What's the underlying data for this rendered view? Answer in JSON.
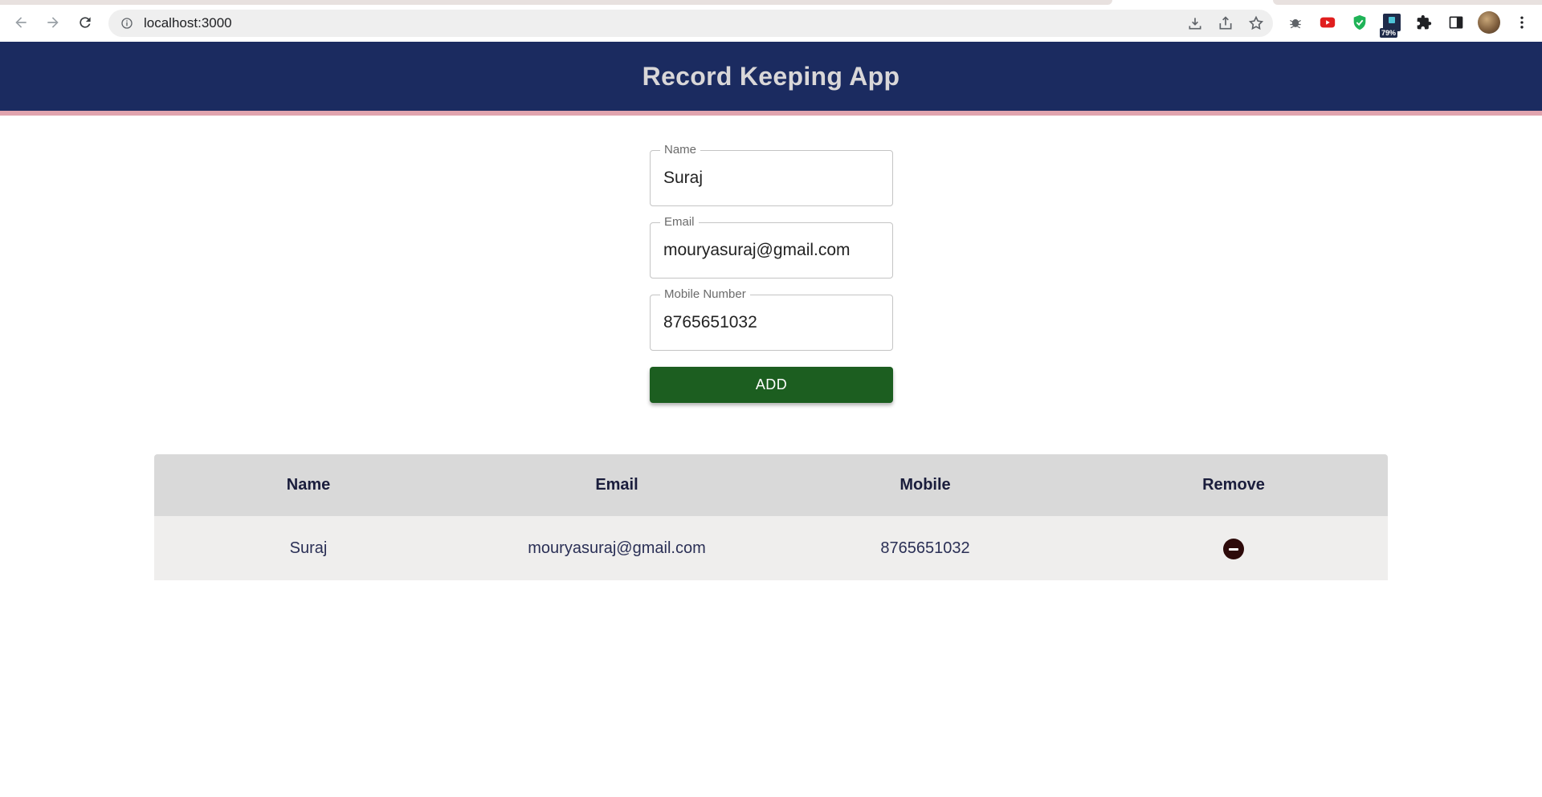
{
  "browser": {
    "url": "localhost:3000",
    "battery_badge": "79%"
  },
  "header": {
    "title": "Record Keeping App",
    "colors": {
      "background": "#1b2b60",
      "accent_border": "#e1a4ae",
      "title_text": "#d9d7d8"
    }
  },
  "form": {
    "name_label": "Name",
    "name_value": "Suraj",
    "email_label": "Email",
    "email_value": "mouryasuraj@gmail.com",
    "mobile_label": "Mobile Number",
    "mobile_value": "8765651032",
    "add_label": "ADD",
    "add_color": "#1c5e20"
  },
  "table": {
    "headers": [
      "Name",
      "Email",
      "Mobile",
      "Remove"
    ],
    "rows": [
      {
        "name": "Suraj",
        "email": "mouryasuraj@gmail.com",
        "mobile": "8765651032",
        "remove_icon": "remove-circle-icon"
      }
    ]
  }
}
